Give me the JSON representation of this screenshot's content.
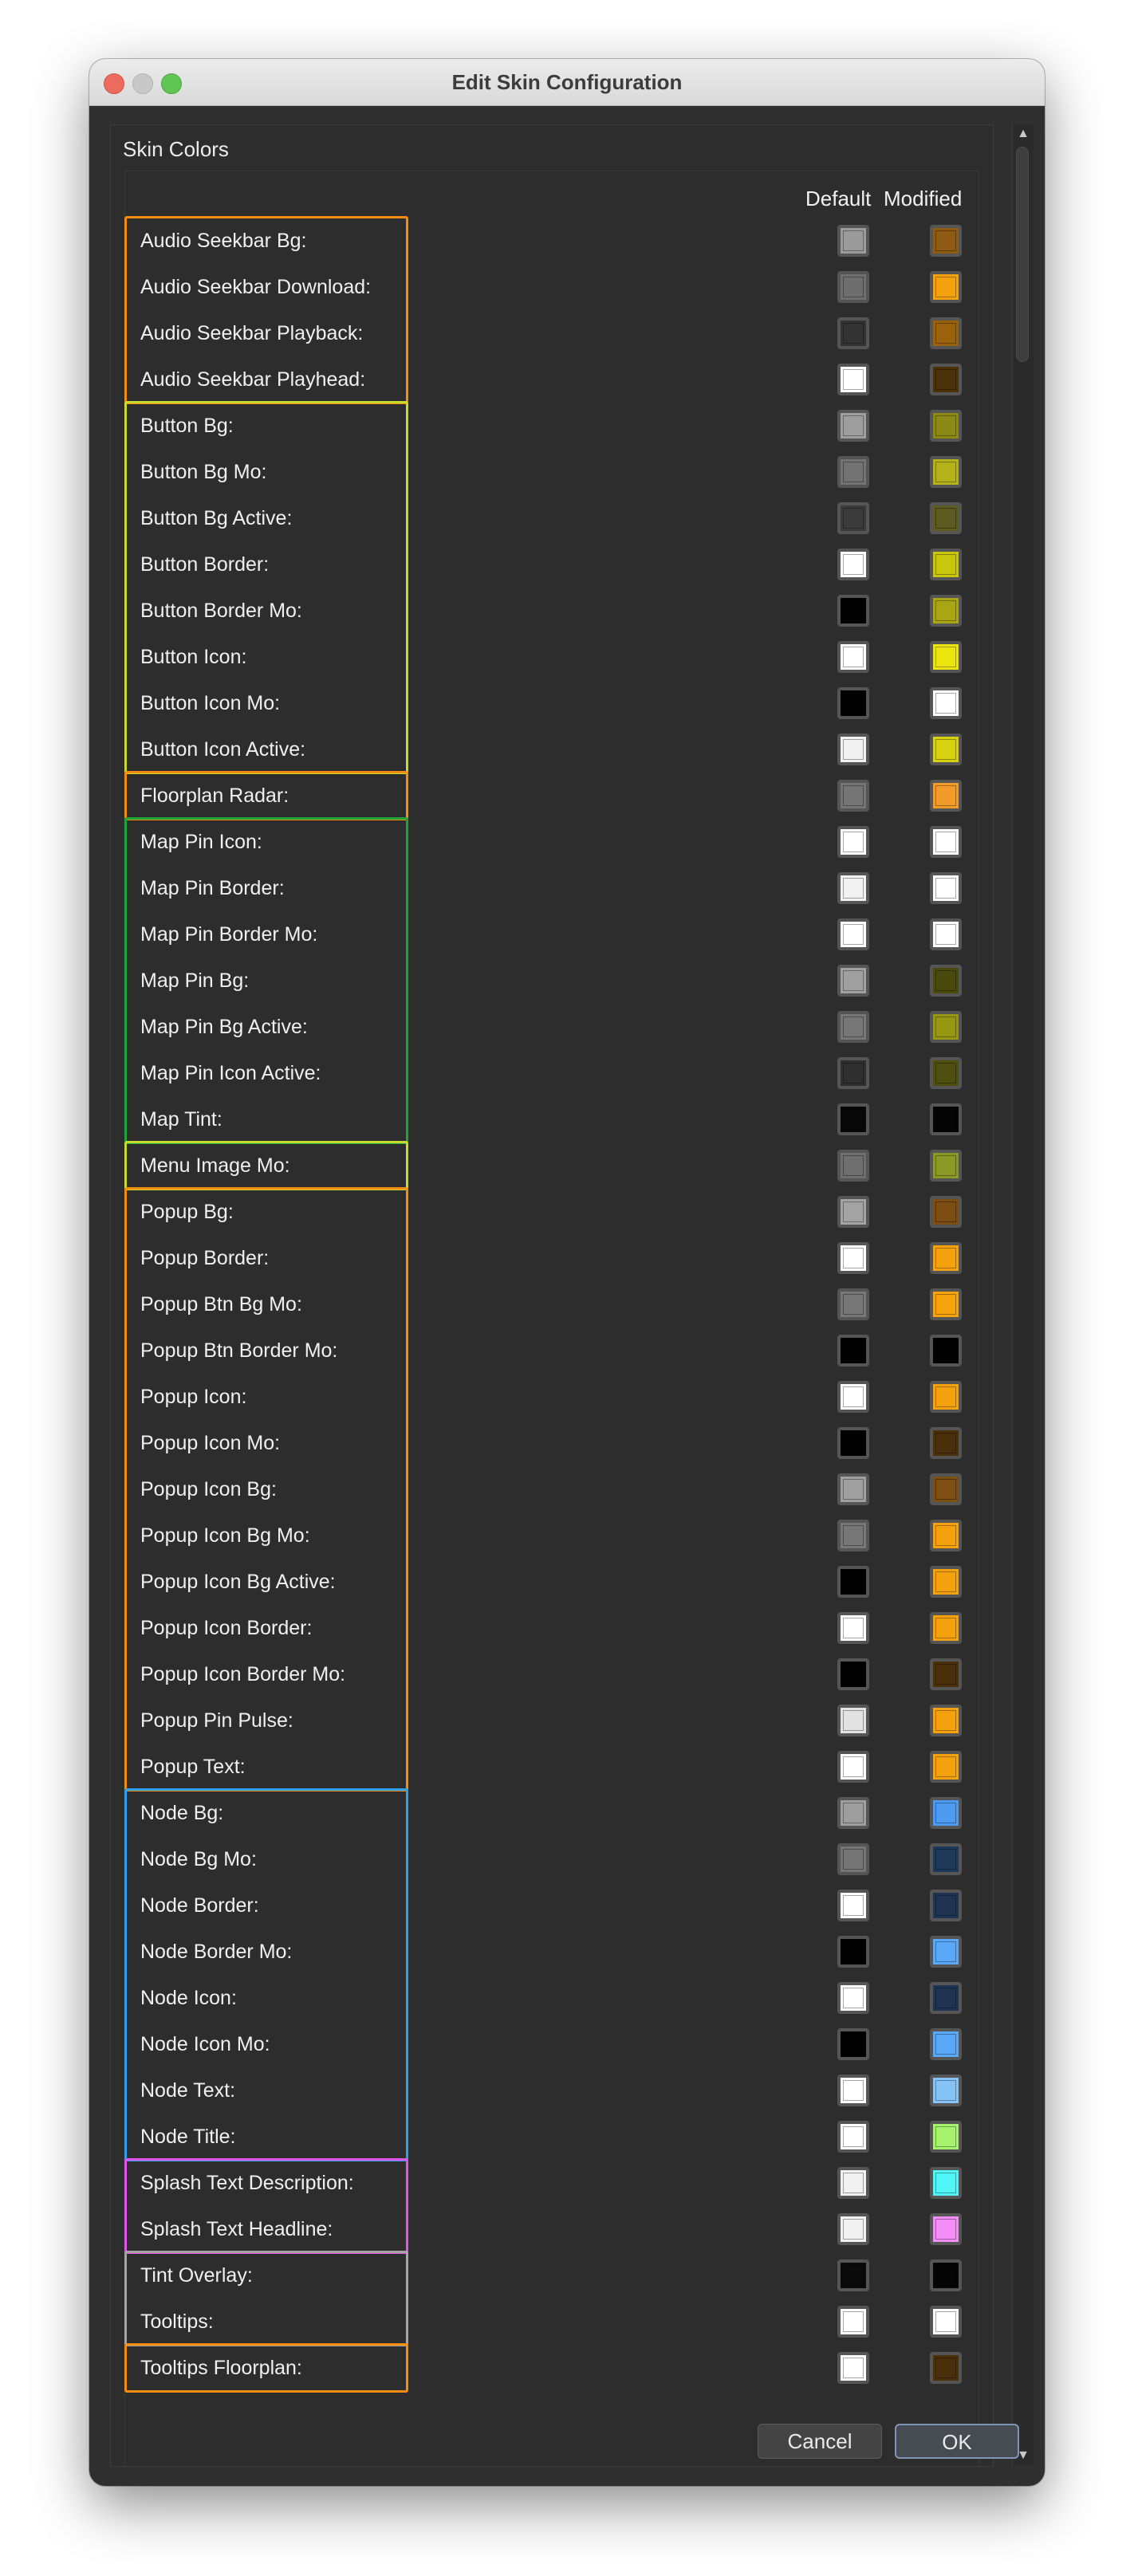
{
  "window": {
    "title": "Edit Skin Configuration"
  },
  "panel": {
    "group_label": "Skin Colors",
    "column_default": "Default",
    "column_modified": "Modified"
  },
  "rows": [
    {
      "label": "Audio Seekbar Bg:",
      "default": "#9b9b9b",
      "modified": "#8f5a12"
    },
    {
      "label": "Audio Seekbar Download:",
      "default": "#6e6e6e",
      "modified": "#f6a20e"
    },
    {
      "label": "Audio Seekbar Playback:",
      "default": "#333333",
      "modified": "#9a620a"
    },
    {
      "label": "Audio Seekbar Playhead:",
      "default": "#ffffff",
      "modified": "#4d3108"
    },
    {
      "label": "Button Bg:",
      "default": "#9e9e9e",
      "modified": "#8c8a14"
    },
    {
      "label": "Button Bg Mo:",
      "default": "#737373",
      "modified": "#b5b319"
    },
    {
      "label": "Button Bg Active:",
      "default": "#3b3b3b",
      "modified": "#5e5b20"
    },
    {
      "label": "Button Border:",
      "default": "#ffffff",
      "modified": "#c9c60c"
    },
    {
      "label": "Button Border Mo:",
      "default": "#000000",
      "modified": "#aaa513"
    },
    {
      "label": "Button Icon:",
      "default": "#ffffff",
      "modified": "#ece40e"
    },
    {
      "label": "Button Icon Mo:",
      "default": "#000000",
      "modified": "#ffffff"
    },
    {
      "label": "Button Icon Active:",
      "default": "#f1f1f1",
      "modified": "#d6d20f"
    },
    {
      "label": "Floorplan Radar:",
      "default": "#757575",
      "modified": "#f29a2a"
    },
    {
      "label": "Map Pin Icon:",
      "default": "#ffffff",
      "modified": "#ffffff"
    },
    {
      "label": "Map Pin Border:",
      "default": "#f2f2f2",
      "modified": "#ffffff"
    },
    {
      "label": "Map Pin Border Mo:",
      "default": "#ffffff",
      "modified": "#ffffff"
    },
    {
      "label": "Map Pin Bg:",
      "default": "#a0a0a0",
      "modified": "#494a0b"
    },
    {
      "label": "Map Pin Bg Active:",
      "default": "#777777",
      "modified": "#989714"
    },
    {
      "label": "Map Pin Icon Active:",
      "default": "#2f2f2f",
      "modified": "#4e4e0e"
    },
    {
      "label": "Map Tint:",
      "default": "#080808",
      "modified": "#050505"
    },
    {
      "label": "Menu Image Mo:",
      "default": "#6f6f6f",
      "modified": "#8b9a26"
    },
    {
      "label": "Popup Bg:",
      "default": "#a3a3a3",
      "modified": "#7c4e12"
    },
    {
      "label": "Popup Border:",
      "default": "#ffffff",
      "modified": "#f6a20e"
    },
    {
      "label": "Popup Btn Bg Mo:",
      "default": "#777777",
      "modified": "#f7a30d"
    },
    {
      "label": "Popup Btn Border Mo:",
      "default": "#000000",
      "modified": "#000000"
    },
    {
      "label": "Popup Icon:",
      "default": "#ffffff",
      "modified": "#f6a20e"
    },
    {
      "label": "Popup Icon Mo:",
      "default": "#000000",
      "modified": "#4a300b"
    },
    {
      "label": "Popup Icon Bg:",
      "default": "#9f9f9f",
      "modified": "#7d4f12"
    },
    {
      "label": "Popup Icon Bg Mo:",
      "default": "#777777",
      "modified": "#f6a20e"
    },
    {
      "label": "Popup Icon Bg Active:",
      "default": "#000000",
      "modified": "#f6a20e"
    },
    {
      "label": "Popup Icon Border:",
      "default": "#ffffff",
      "modified": "#f6a20e"
    },
    {
      "label": "Popup Icon Border Mo:",
      "default": "#000000",
      "modified": "#4a300b"
    },
    {
      "label": "Popup Pin Pulse:",
      "default": "#e2e2e2",
      "modified": "#f6a20e"
    },
    {
      "label": "Popup Text:",
      "default": "#ffffff",
      "modified": "#f6a20e"
    },
    {
      "label": "Node Bg:",
      "default": "#9e9e9e",
      "modified": "#4e9cf2"
    },
    {
      "label": "Node Bg Mo:",
      "default": "#757575",
      "modified": "#1d3a5a"
    },
    {
      "label": "Node Border:",
      "default": "#ffffff",
      "modified": "#1e3452"
    },
    {
      "label": "Node Border Mo:",
      "default": "#000000",
      "modified": "#5aa8f8"
    },
    {
      "label": "Node Icon:",
      "default": "#ffffff",
      "modified": "#1e3452"
    },
    {
      "label": "Node Icon Mo:",
      "default": "#000000",
      "modified": "#5aa8f8"
    },
    {
      "label": "Node Text:",
      "default": "#ffffff",
      "modified": "#86c4f8"
    },
    {
      "label": "Node Title:",
      "default": "#ffffff",
      "modified": "#a6f26c"
    },
    {
      "label": "Splash Text Description:",
      "default": "#f1f1f1",
      "modified": "#52f6f6"
    },
    {
      "label": "Splash Text Headline:",
      "default": "#f1f1f1",
      "modified": "#f28ef5"
    },
    {
      "label": "Tint Overlay:",
      "default": "#0a0a0a",
      "modified": "#050505"
    },
    {
      "label": "Tooltips:",
      "default": "#ffffff",
      "modified": "#ffffff"
    },
    {
      "label": "Tooltips Floorplan:",
      "default": "#ffffff",
      "modified": "#4a300b"
    }
  ],
  "groups": [
    {
      "name": "audio-seekbar-group",
      "start": 0,
      "end": 3,
      "color": "#f28c13"
    },
    {
      "name": "button-group",
      "start": 4,
      "end": 11,
      "color": "#c7d92c"
    },
    {
      "name": "floorplan-group",
      "start": 12,
      "end": 12,
      "color": "#f28c13"
    },
    {
      "name": "map-pin-group",
      "start": 13,
      "end": 19,
      "color": "#1da53c"
    },
    {
      "name": "menu-group",
      "start": 20,
      "end": 20,
      "color": "#c7d92c"
    },
    {
      "name": "popup-group",
      "start": 21,
      "end": 33,
      "color": "#f28c13"
    },
    {
      "name": "node-group",
      "start": 34,
      "end": 41,
      "color": "#2da0ec"
    },
    {
      "name": "splash-group",
      "start": 42,
      "end": 43,
      "color": "#e155e8"
    },
    {
      "name": "tint-tooltips-group",
      "start": 44,
      "end": 45,
      "color": "#a5a5a5"
    },
    {
      "name": "tooltips-floorplan-group",
      "start": 46,
      "end": 46,
      "color": "#f28c13"
    }
  ],
  "buttons": {
    "cancel": "Cancel",
    "ok": "OK"
  }
}
